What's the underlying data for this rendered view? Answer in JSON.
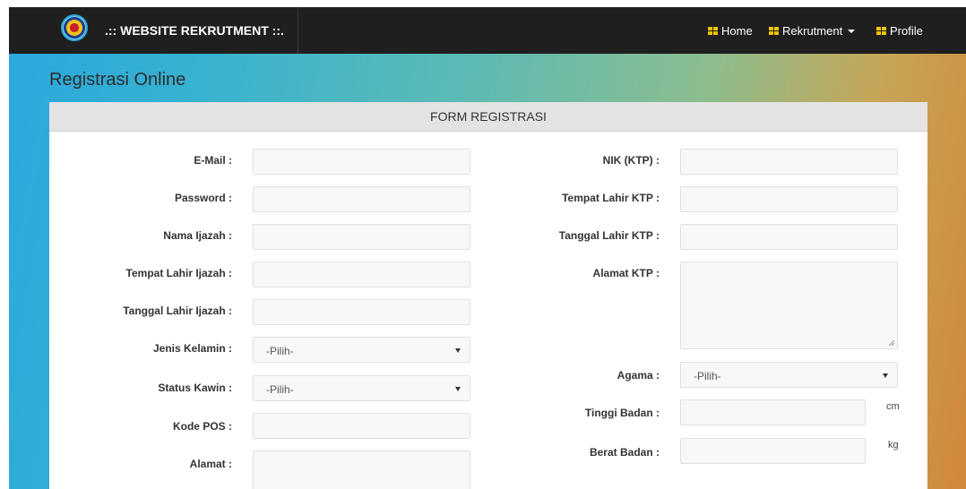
{
  "navbar": {
    "brand": ".:: WEBSITE REKRUTMENT ::.",
    "items": [
      {
        "label": "Home",
        "icon": "grid-icon"
      },
      {
        "label": "Rekrutment",
        "icon": "grid-icon",
        "dropdown": true
      },
      {
        "label": "Profile",
        "icon": "grid-icon"
      }
    ]
  },
  "page": {
    "title": "Registrasi Online"
  },
  "form": {
    "header": "FORM REGISTRASI",
    "left": {
      "email_label": "E-Mail :",
      "password_label": "Password :",
      "nama_label": "Nama Ijazah :",
      "tempat_lahir_label": "Tempat Lahir Ijazah :",
      "tanggal_lahir_label": "Tanggal Lahir Ijazah :",
      "jenis_kelamin_label": "Jenis Kelamin :",
      "jenis_kelamin_value": "-Pilih-",
      "status_kawin_label": "Status Kawin :",
      "status_kawin_value": "-Pilih-",
      "kode_pos_label": "Kode POS :",
      "alamat_label": "Alamat :"
    },
    "right": {
      "nik_label": "NIK (KTP) :",
      "tempat_lahir_ktp_label": "Tempat Lahir KTP :",
      "tanggal_lahir_ktp_label": "Tanggal Lahir KTP :",
      "alamat_ktp_label": "Alamat KTP :",
      "agama_label": "Agama :",
      "agama_value": "-Pilih-",
      "tinggi_badan_label": "Tinggi Badan :",
      "tinggi_unit": "cm",
      "berat_badan_label": "Berat Badan :",
      "berat_unit": "kg"
    }
  }
}
